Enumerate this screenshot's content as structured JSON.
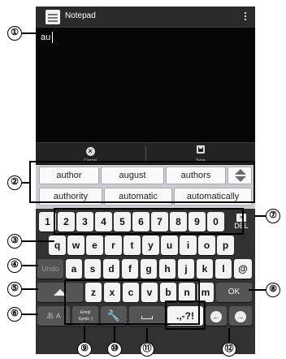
{
  "app": {
    "title": "Notepad",
    "icon": "notepad-icon",
    "menu_icon": "overflow-menu-icon"
  },
  "editor": {
    "text": "au"
  },
  "action_bar": {
    "cancel_label": "Cancel",
    "save_label": "Save"
  },
  "suggestions": [
    "author",
    "august",
    "authors",
    "authority",
    "automatic",
    "automatically"
  ],
  "keyboard": {
    "number_row": [
      "1",
      "2",
      "3",
      "4",
      "5",
      "6",
      "7",
      "8",
      "9",
      "0"
    ],
    "row_q": [
      "q",
      "w",
      "e",
      "r",
      "t",
      "y",
      "u",
      "i",
      "o",
      "p"
    ],
    "row_a": [
      "a",
      "s",
      "d",
      "f",
      "g",
      "h",
      "j",
      "k",
      "l",
      "@"
    ],
    "row_z": [
      "z",
      "x",
      "c",
      "v",
      "b",
      "n",
      "m"
    ],
    "del_label": "DEL",
    "undo_label": "Undo",
    "ok_label": "OK",
    "mode_label": "あ A",
    "emoji_label_1": "Emoji",
    "emoji_label_2": "Symb:-)",
    "punct_label": ".,-?!"
  },
  "callouts": [
    "①",
    "②",
    "③",
    "④",
    "⑤",
    "⑥",
    "⑦",
    "⑧",
    "⑨",
    "⑩",
    "⑪",
    "⑫"
  ],
  "colors": {
    "screen_bg": "#000000",
    "suggest_bg": "#c9ccd1",
    "keyboard_bg": "#313131",
    "key_face": "#f3f3f3"
  }
}
